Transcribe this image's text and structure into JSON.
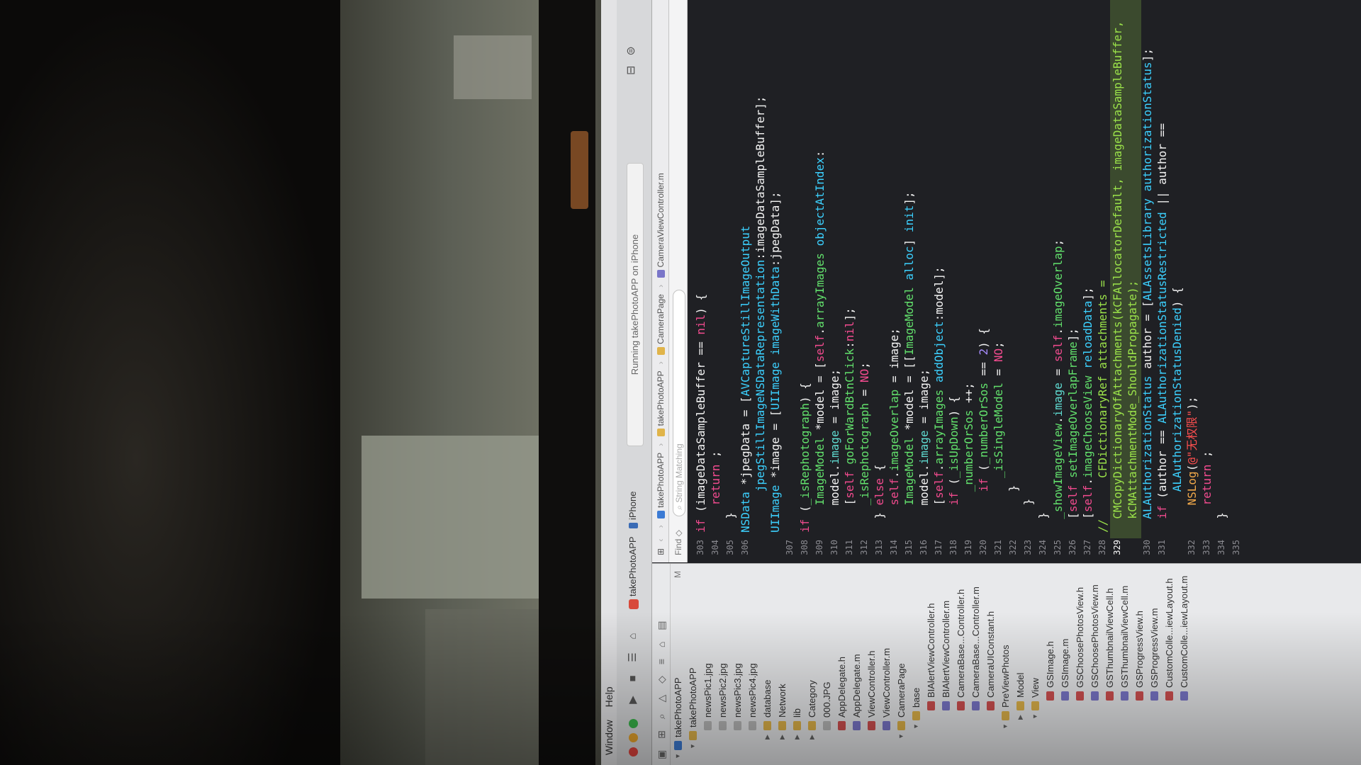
{
  "menubar": {
    "items": [
      "Window",
      "Help"
    ]
  },
  "toolbar": {
    "scheme": "takePhotoAPP",
    "device": "iPhone",
    "status": "Running takePhotoAPP on iPhone"
  },
  "jumpbar": {
    "crumbs": [
      "takePhotoAPP",
      "takePhotoAPP",
      "CameraPage",
      "CameraViewController.m"
    ]
  },
  "findbar": {
    "label": "Find",
    "placeholder": "String Matching"
  },
  "navigator": {
    "files": [
      {
        "name": "takePhotoAPP",
        "kind": "proj",
        "depth": 0,
        "open": true,
        "mark": "M"
      },
      {
        "name": "takePhotoAPP",
        "kind": "folder",
        "depth": 1,
        "open": true
      },
      {
        "name": "newsPic1.jpg",
        "kind": "img",
        "depth": 2
      },
      {
        "name": "newsPic2.jpg",
        "kind": "img",
        "depth": 2
      },
      {
        "name": "newsPic3.jpg",
        "kind": "img",
        "depth": 2
      },
      {
        "name": "newsPic4.jpg",
        "kind": "img",
        "depth": 2
      },
      {
        "name": "database",
        "kind": "folder",
        "depth": 2,
        "closed": true
      },
      {
        "name": "Network",
        "kind": "folder",
        "depth": 2,
        "closed": true
      },
      {
        "name": "lib",
        "kind": "folder",
        "depth": 2,
        "closed": true
      },
      {
        "name": "Category",
        "kind": "folder",
        "depth": 2,
        "closed": true
      },
      {
        "name": "000.JPG",
        "kind": "img",
        "depth": 2
      },
      {
        "name": "AppDelegate.h",
        "kind": "h",
        "depth": 2
      },
      {
        "name": "AppDelegate.m",
        "kind": "m",
        "depth": 2
      },
      {
        "name": "ViewController.h",
        "kind": "h",
        "depth": 2
      },
      {
        "name": "ViewController.m",
        "kind": "m",
        "depth": 2
      },
      {
        "name": "CameraPage",
        "kind": "folder",
        "depth": 2,
        "open": true
      },
      {
        "name": "base",
        "kind": "folder",
        "depth": 3,
        "open": true
      },
      {
        "name": "BIAlertViewController.h",
        "kind": "h",
        "depth": 4
      },
      {
        "name": "BIAlertViewController.m",
        "kind": "m",
        "depth": 4
      },
      {
        "name": "CameraBase...Controller.h",
        "kind": "h",
        "depth": 4
      },
      {
        "name": "CameraBase...Controller.m",
        "kind": "m",
        "depth": 4
      },
      {
        "name": "CameraUIConstant.h",
        "kind": "h",
        "depth": 4
      },
      {
        "name": "PreViewPhotos",
        "kind": "folder",
        "depth": 3,
        "open": true
      },
      {
        "name": "Model",
        "kind": "folder",
        "depth": 4,
        "closed": true
      },
      {
        "name": "View",
        "kind": "folder",
        "depth": 4,
        "open": true
      },
      {
        "name": "GSImage.h",
        "kind": "h",
        "depth": 5
      },
      {
        "name": "GSImage.m",
        "kind": "m",
        "depth": 5
      },
      {
        "name": "GSChoosePhotosView.h",
        "kind": "h",
        "depth": 5
      },
      {
        "name": "GSChoosePhotosView.m",
        "kind": "m",
        "depth": 5
      },
      {
        "name": "GSThumbnailViewCell.h",
        "kind": "h",
        "depth": 5
      },
      {
        "name": "GSThumbnailViewCell.m",
        "kind": "m",
        "depth": 5
      },
      {
        "name": "GSProgressView.h",
        "kind": "h",
        "depth": 5
      },
      {
        "name": "GSProgressView.m",
        "kind": "m",
        "depth": 5
      },
      {
        "name": "CustomColle...iewLayout.h",
        "kind": "h",
        "depth": 5
      },
      {
        "name": "CustomColle...iewLayout.m",
        "kind": "m",
        "depth": 5
      }
    ]
  },
  "editor": {
    "current_line": "329",
    "lines": [
      {
        "n": "303",
        "code": [
          [
            "kw",
            "if "
          ],
          [
            "pl",
            "(imageDataSampleBuffer == "
          ],
          [
            "kw",
            "nil"
          ],
          [
            "pl",
            ") {"
          ]
        ]
      },
      {
        "n": "304",
        "code": [
          [
            "pl",
            "    "
          ],
          [
            "kw",
            "return"
          ],
          [
            "pl",
            " ;"
          ]
        ]
      },
      {
        "n": "305",
        "code": [
          [
            "pl",
            "  }"
          ]
        ]
      },
      {
        "n": "306",
        "code": [
          [
            "ty",
            "NSData"
          ],
          [
            "pl",
            " *jpegData = ["
          ],
          [
            "ty",
            "AVCaptureStillImageOutput"
          ]
        ]
      },
      {
        "n": "",
        "code": [
          [
            "pl",
            "      "
          ],
          [
            "ty",
            "jpegStillImageNSDataRepresentation"
          ],
          [
            "pl",
            ":imageDataSampleBuffer];"
          ]
        ]
      },
      {
        "n": "",
        "code": [
          [
            "ty",
            "UIImage"
          ],
          [
            "pl",
            " *image = ["
          ],
          [
            "ty",
            "UIImage"
          ],
          [
            "pl",
            " "
          ],
          [
            "ty",
            "imageWithData"
          ],
          [
            "pl",
            ":jpegData];"
          ]
        ]
      },
      {
        "n": "307",
        "code": [
          [
            "pl",
            ""
          ]
        ]
      },
      {
        "n": "308",
        "code": [
          [
            "kw",
            "if"
          ],
          [
            "pl",
            " ("
          ],
          [
            "fn",
            "_isRephotograph"
          ],
          [
            "pl",
            ") {"
          ]
        ]
      },
      {
        "n": "309",
        "code": [
          [
            "pl",
            "    "
          ],
          [
            "fn",
            "ImageModel"
          ],
          [
            "pl",
            " *model = ["
          ],
          [
            "kw",
            "self"
          ],
          [
            "pl",
            "."
          ],
          [
            "fn",
            "arrayImages"
          ],
          [
            "pl",
            " "
          ],
          [
            "ty",
            "objectAtIndex"
          ],
          [
            "pl",
            ":"
          ]
        ]
      },
      {
        "n": "310",
        "code": [
          [
            "pl",
            "    model."
          ],
          [
            "pr",
            "image"
          ],
          [
            "pl",
            " = image;"
          ]
        ]
      },
      {
        "n": "311",
        "code": [
          [
            "pl",
            "    ["
          ],
          [
            "kw",
            "self"
          ],
          [
            "pl",
            " "
          ],
          [
            "fn",
            "goForWardBtnClick"
          ],
          [
            "pl",
            ":"
          ],
          [
            "kw",
            "nil"
          ],
          [
            "pl",
            "];"
          ]
        ]
      },
      {
        "n": "312",
        "code": [
          [
            "pl",
            "    "
          ],
          [
            "fn",
            "_isRephotograph"
          ],
          [
            "pl",
            " = "
          ],
          [
            "kw",
            "NO"
          ],
          [
            "pl",
            ";"
          ]
        ]
      },
      {
        "n": "313",
        "code": [
          [
            "pl",
            "  } "
          ],
          [
            "kw",
            "else"
          ],
          [
            "pl",
            " {"
          ]
        ]
      },
      {
        "n": "314",
        "code": [
          [
            "pl",
            "    "
          ],
          [
            "kw",
            "self"
          ],
          [
            "pl",
            "."
          ],
          [
            "fn",
            "imageOverlap"
          ],
          [
            "pl",
            " = image;"
          ]
        ]
      },
      {
        "n": "315",
        "code": [
          [
            "pl",
            "    "
          ],
          [
            "fn",
            "ImageModel"
          ],
          [
            "pl",
            " *model = [["
          ],
          [
            "fn",
            "ImageModel"
          ],
          [
            "pl",
            " "
          ],
          [
            "ty",
            "alloc"
          ],
          [
            "pl",
            "] "
          ],
          [
            "ty",
            "init"
          ],
          [
            "pl",
            "];"
          ]
        ]
      },
      {
        "n": "316",
        "code": [
          [
            "pl",
            "    model."
          ],
          [
            "pr",
            "image"
          ],
          [
            "pl",
            " = image;"
          ]
        ]
      },
      {
        "n": "317",
        "code": [
          [
            "pl",
            "    ["
          ],
          [
            "kw",
            "self"
          ],
          [
            "pl",
            "."
          ],
          [
            "fn",
            "arrayImages"
          ],
          [
            "pl",
            " "
          ],
          [
            "ty",
            "addObject"
          ],
          [
            "pl",
            ":model];"
          ]
        ]
      },
      {
        "n": "318",
        "code": [
          [
            "pl",
            "    "
          ],
          [
            "kw",
            "if"
          ],
          [
            "pl",
            " ("
          ],
          [
            "fn",
            "_isUpDown"
          ],
          [
            "pl",
            ") {"
          ]
        ]
      },
      {
        "n": "319",
        "code": [
          [
            "pl",
            "      "
          ],
          [
            "fn",
            "_numberOrSos"
          ],
          [
            "pl",
            " ++;"
          ]
        ]
      },
      {
        "n": "320",
        "code": [
          [
            "pl",
            "      "
          ],
          [
            "kw",
            "if"
          ],
          [
            "pl",
            " ("
          ],
          [
            "fn",
            "_numberOrSos"
          ],
          [
            "pl",
            " == "
          ],
          [
            "nm",
            "2"
          ],
          [
            "pl",
            ") {"
          ]
        ]
      },
      {
        "n": "321",
        "code": [
          [
            "pl",
            "        "
          ],
          [
            "fn",
            "_isSingleModel"
          ],
          [
            "pl",
            " = "
          ],
          [
            "kw",
            "NO"
          ],
          [
            "pl",
            ";"
          ]
        ]
      },
      {
        "n": "322",
        "code": [
          [
            "pl",
            "      }"
          ]
        ]
      },
      {
        "n": "323",
        "code": [
          [
            "pl",
            "    }"
          ]
        ]
      },
      {
        "n": "324",
        "code": [
          [
            "pl",
            "  }"
          ]
        ]
      },
      {
        "n": "325",
        "code": [
          [
            "pl",
            "  "
          ],
          [
            "fn",
            "_showImageView"
          ],
          [
            "pl",
            "."
          ],
          [
            "pr",
            "image"
          ],
          [
            "pl",
            " = "
          ],
          [
            "kw",
            "self"
          ],
          [
            "pl",
            "."
          ],
          [
            "fn",
            "imageOverlap"
          ],
          [
            "pl",
            ";"
          ]
        ]
      },
      {
        "n": "326",
        "code": [
          [
            "pl",
            "  ["
          ],
          [
            "kw",
            "self"
          ],
          [
            "pl",
            " "
          ],
          [
            "fn",
            "setImageOverlapFrame"
          ],
          [
            "pl",
            "];"
          ]
        ]
      },
      {
        "n": "327",
        "code": [
          [
            "pl",
            "  ["
          ],
          [
            "kw",
            "self"
          ],
          [
            "pl",
            "."
          ],
          [
            "fn",
            "imageChooseView"
          ],
          [
            "pl",
            " "
          ],
          [
            "ty",
            "reloadData"
          ],
          [
            "pl",
            "];"
          ]
        ]
      },
      {
        "n": "328",
        "code": [
          [
            "cm",
            "//      CFDictionaryRef attachments ="
          ]
        ]
      },
      {
        "n": "329",
        "code": [
          [
            "cm",
            "  CMCopyDictionaryOfAttachments(kCFAllocatorDefault, imageDataSampleBuffer,"
          ]
        ]
      },
      {
        "n": "",
        "code": [
          [
            "cm",
            "  kCMAttachmentMode_ShouldPropagate);"
          ]
        ]
      },
      {
        "n": "330",
        "code": [
          [
            "pl",
            "  "
          ],
          [
            "ty",
            "ALAuthorizationStatus"
          ],
          [
            "pl",
            " author = ["
          ],
          [
            "ty",
            "ALAssetsLibrary"
          ],
          [
            "pl",
            " "
          ],
          [
            "ty",
            "authorizationStatus"
          ],
          [
            "pl",
            "];"
          ]
        ]
      },
      {
        "n": "331",
        "code": [
          [
            "pl",
            "  "
          ],
          [
            "kw",
            "if"
          ],
          [
            "pl",
            " (author == "
          ],
          [
            "ty",
            "ALAuthorizationStatusRestricted"
          ],
          [
            "pl",
            " || author =="
          ]
        ]
      },
      {
        "n": "",
        "code": [
          [
            "pl",
            "      "
          ],
          [
            "ty",
            "ALAuthorizationStatusDenied"
          ],
          [
            "pl",
            ") {"
          ]
        ]
      },
      {
        "n": "332",
        "code": [
          [
            "pl",
            "    "
          ],
          [
            "ma",
            "NSLog"
          ],
          [
            "pl",
            "("
          ],
          [
            "st",
            "@\"无权限\""
          ],
          [
            "pl",
            ");"
          ]
        ]
      },
      {
        "n": "333",
        "code": [
          [
            "pl",
            "    "
          ],
          [
            "kw",
            "return"
          ],
          [
            "pl",
            " ;"
          ]
        ]
      },
      {
        "n": "334",
        "code": [
          [
            "pl",
            "  }"
          ]
        ]
      },
      {
        "n": "335",
        "code": [
          [
            "pl",
            ""
          ]
        ]
      }
    ]
  }
}
